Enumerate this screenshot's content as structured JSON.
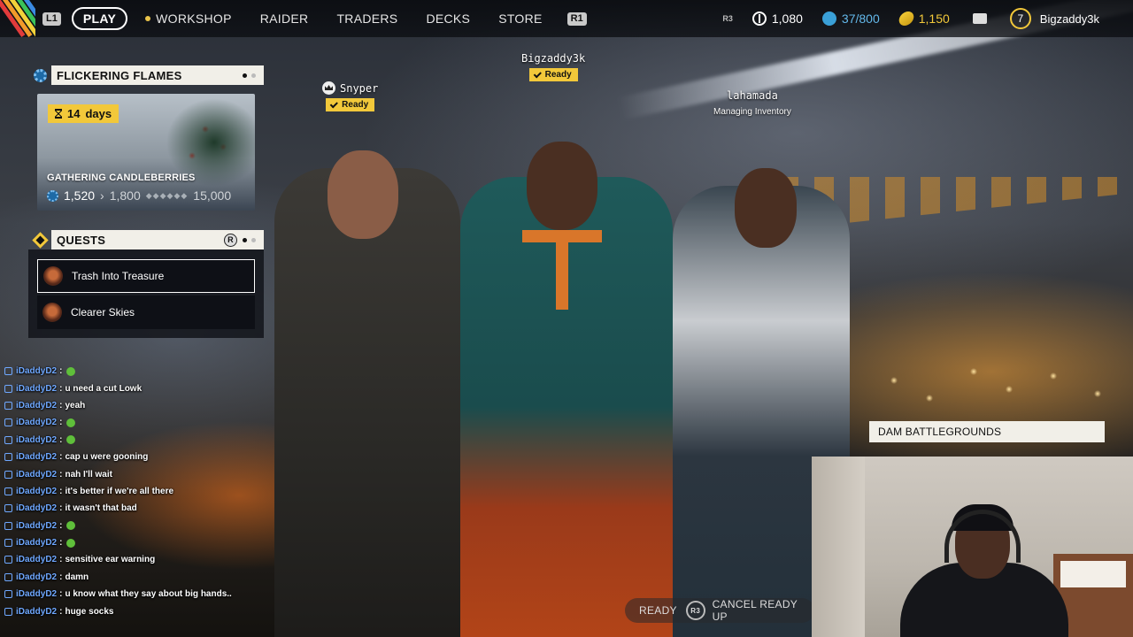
{
  "nav": {
    "l1": "L1",
    "play": "PLAY",
    "items": [
      "WORKSHOP",
      "RAIDER",
      "TRADERS",
      "DECKS",
      "STORE"
    ],
    "r1": "R1",
    "r3": "R3",
    "currency_coins": "1,080",
    "currency_blue": "37/800",
    "currency_gold": "1,150",
    "level": "7",
    "username": "Bigzaddy3k"
  },
  "event": {
    "header": "FLICKERING FLAMES",
    "days_num": "14",
    "days_label": "days",
    "name": "GATHERING CANDLEBERRIES",
    "progress_current": "1,520",
    "progress_next": "1,800",
    "progress_max": "15,000"
  },
  "quests": {
    "header": "QUESTS",
    "r_button": "R",
    "items": [
      "Trash Into Treasure",
      "Clearer Skies"
    ]
  },
  "players": [
    {
      "name": "Snyper",
      "status": "Ready"
    },
    {
      "name": "Bigzaddy3k",
      "status": "Ready"
    },
    {
      "name": "lahamada",
      "status": "Managing Inventory"
    }
  ],
  "chat": [
    {
      "user": "iDaddyD2",
      "msg": "",
      "emote": true
    },
    {
      "user": "iDaddyD2",
      "msg": "u need a cut Lowk",
      "emote": false
    },
    {
      "user": "iDaddyD2",
      "msg": "yeah",
      "emote": false
    },
    {
      "user": "iDaddyD2",
      "msg": "",
      "emote": true
    },
    {
      "user": "iDaddyD2",
      "msg": "",
      "emote": true
    },
    {
      "user": "iDaddyD2",
      "msg": "cap u were gooning",
      "emote": false
    },
    {
      "user": "iDaddyD2",
      "msg": "nah I'll wait",
      "emote": false
    },
    {
      "user": "iDaddyD2",
      "msg": "it's better if we're all there",
      "emote": false
    },
    {
      "user": "iDaddyD2",
      "msg": "it wasn't that bad",
      "emote": false
    },
    {
      "user": "iDaddyD2",
      "msg": "",
      "emote": true
    },
    {
      "user": "iDaddyD2",
      "msg": "",
      "emote": true
    },
    {
      "user": "iDaddyD2",
      "msg": "sensitive ear warning",
      "emote": false
    },
    {
      "user": "iDaddyD2",
      "msg": "damn",
      "emote": false
    },
    {
      "user": "iDaddyD2",
      "msg": "u know what they say about big hands..",
      "emote": false
    },
    {
      "user": "iDaddyD2",
      "msg": "huge socks",
      "emote": false
    }
  ],
  "prompts": {
    "ready": "READY",
    "r3": "R3",
    "cancel": "CANCEL READY UP"
  },
  "map": {
    "name": "DAM BATTLEGROUNDS"
  },
  "colors": {
    "accent_yellow": "#f2c83a",
    "chat_user": "#6fa8ff",
    "panel_label_bg": "#f1efe8"
  }
}
